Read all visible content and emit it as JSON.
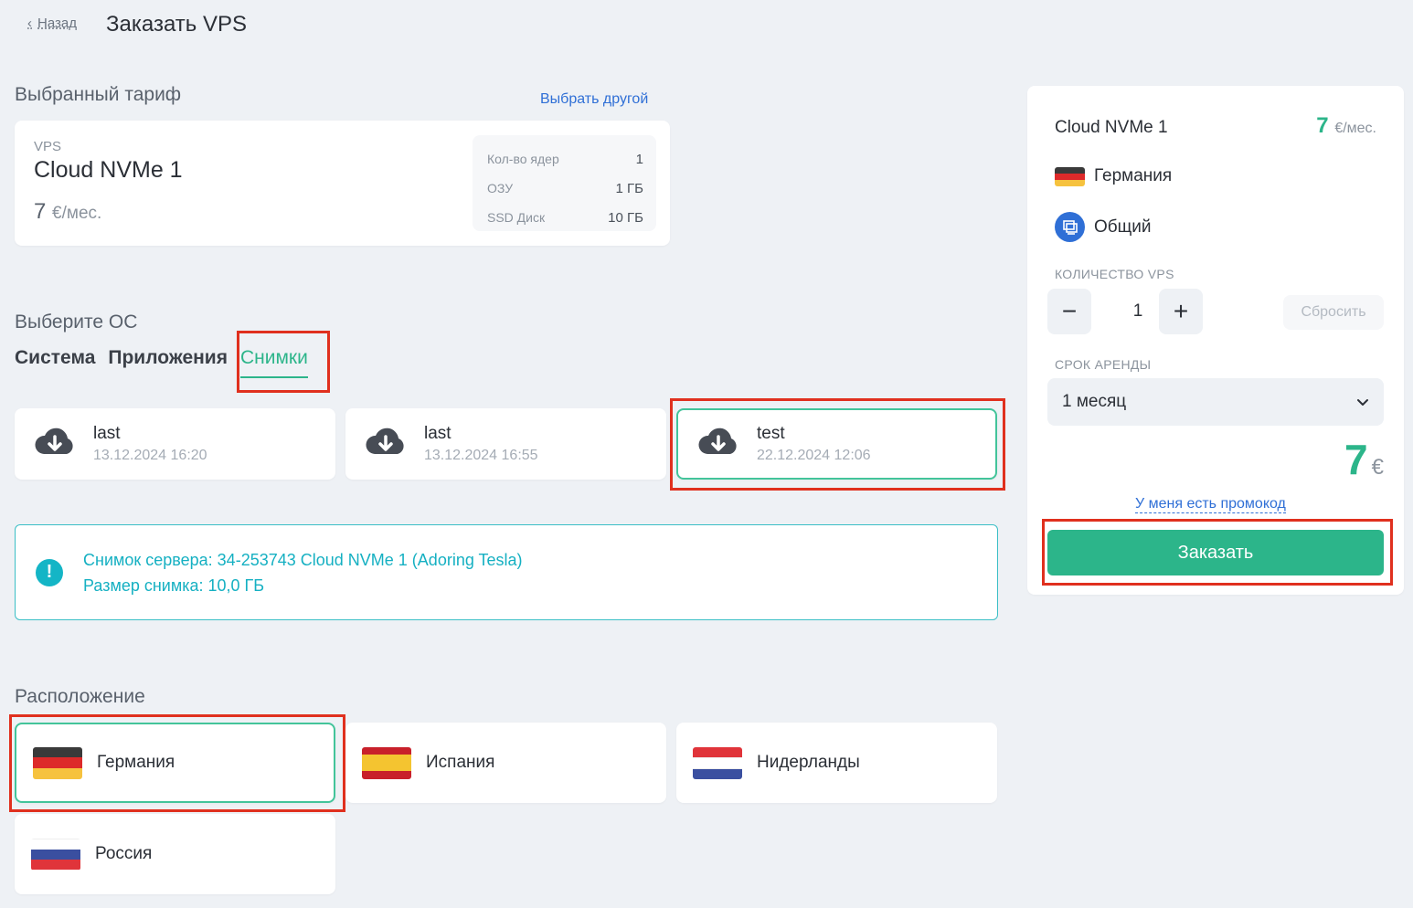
{
  "header": {
    "back_label": "Назад",
    "title": "Заказать VPS"
  },
  "tariff": {
    "section_title": "Выбранный тариф",
    "change_link": "Выбрать другой",
    "type": "VPS",
    "name": "Cloud NVMe 1",
    "price": "7",
    "price_unit": "€/мес.",
    "specs": [
      {
        "key": "Кол-во ядер",
        "value": "1"
      },
      {
        "key": "ОЗУ",
        "value": "1 ГБ"
      },
      {
        "key": "SSD Диск",
        "value": "10 ГБ"
      }
    ]
  },
  "os": {
    "section_title": "Выберите ОС",
    "tabs": [
      {
        "label": "Система"
      },
      {
        "label": "Приложения"
      },
      {
        "label": "Снимки",
        "active": true
      }
    ],
    "snapshots": [
      {
        "name": "last",
        "date": "13.12.2024 16:20",
        "icon": "cloud-download-icon"
      },
      {
        "name": "last",
        "date": "13.12.2024 16:55",
        "icon": "cloud-download-icon"
      },
      {
        "name": "test",
        "date": "22.12.2024 12:06",
        "icon": "cloud-download-icon",
        "selected": true
      }
    ]
  },
  "info": {
    "icon": "exclamation-icon",
    "line1": "Снимок сервера: 34-253743 Cloud NVMe 1 (Adoring Tesla)",
    "line2": "Размер снимка: 10,0 ГБ"
  },
  "location": {
    "section_title": "Расположение",
    "items": [
      {
        "name": "Германия",
        "selected": true,
        "colors": [
          "#3a3a3a",
          "#dd2a2a",
          "#f6c23e"
        ]
      },
      {
        "name": "Испания",
        "colors": [
          "#c8202a",
          "#f4c430",
          "#c8202a"
        ]
      },
      {
        "name": "Нидерланды",
        "colors": [
          "#e0343a",
          "#ffffff",
          "#3a4fa0"
        ]
      },
      {
        "name": "Россия",
        "colors": [
          "#ffffff",
          "#3a4fa0",
          "#e0343a"
        ]
      }
    ]
  },
  "summary": {
    "tariff_name": "Cloud NVMe 1",
    "price": "7",
    "price_unit": "€/мес.",
    "country": "Германия",
    "network": "Общий",
    "qty_label": "КОЛИЧЕСТВО VPS",
    "qty_minus": "−",
    "qty_value": "1",
    "qty_plus": "+",
    "reset_label": "Сбросить",
    "period_label": "СРОК АРЕНДЫ",
    "period_value": "1 месяц",
    "total": "7",
    "total_unit": "€",
    "promo_link": "У меня есть промокод",
    "order_button": "Заказать"
  },
  "colors": {
    "accent": "#2cb58a",
    "link": "#2f6fd6",
    "info": "#15b0c2",
    "highlight": "#e0301e"
  }
}
